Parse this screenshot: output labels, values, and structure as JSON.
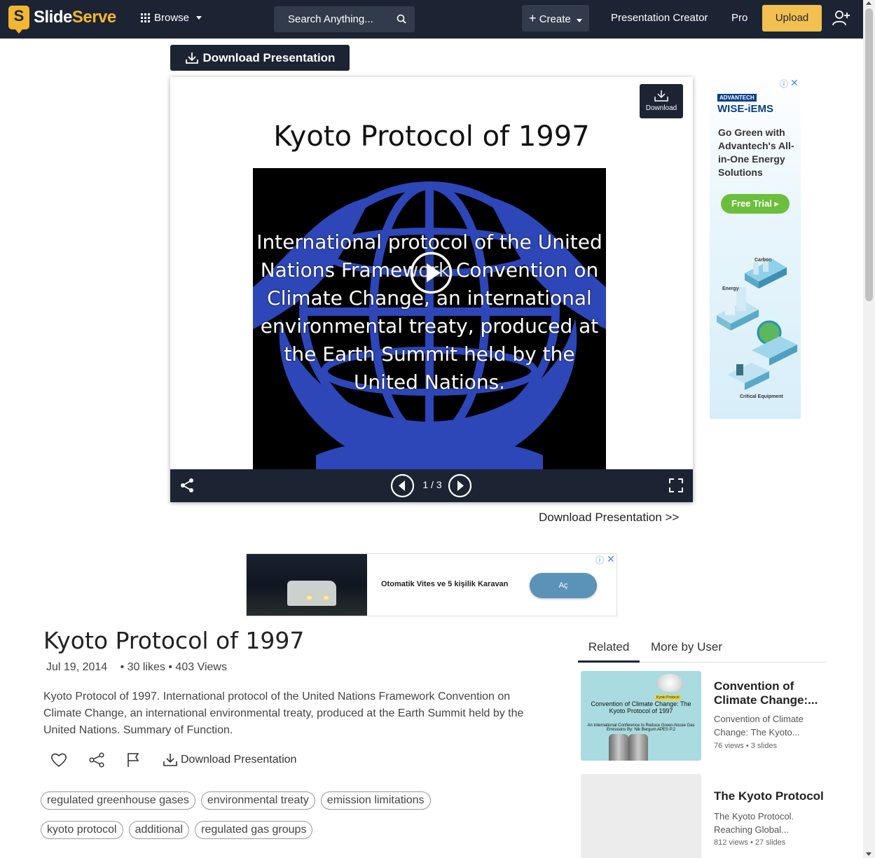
{
  "nav": {
    "logo_s": "S",
    "logo_slide": "Slide",
    "logo_serve": "Serve",
    "browse": "Browse",
    "search_placeholder": "Search Anything...",
    "create": "Create",
    "presentation_creator": "Presentation Creator",
    "pro": "Pro",
    "upload": "Upload"
  },
  "viewer": {
    "download_button": "Download Presentation",
    "corner_download": "Download",
    "slide_title": "Kyoto Protocol of 1997",
    "slide_text": "International protocol of the United Nations Framework Convention on Climate Change, an international environmental treaty, produced at the Earth Summit held by the United Nations.",
    "page_counter": "1 / 3",
    "download_link": "Download Presentation >>"
  },
  "side_ad": {
    "brand": "ADVANTECH",
    "product": "WISE-iEMS",
    "copy": "Go Green with Advantech's All-in-One Energy Solutions",
    "cta": "Free Trial ▸",
    "label_carbon": "Carbon",
    "label_energy": "Energy",
    "label_critical": "Critical Equipment"
  },
  "banner_ad": {
    "text": "Otomatik Vites ve 5 kişilik Karavan",
    "button": "Aç"
  },
  "details": {
    "title": "Kyoto Protocol of 1997",
    "date": "Jul 19, 2014",
    "likes_views": "• 30 likes • 403 Views",
    "description": "Kyoto Protocol of 1997. International protocol of the United Nations Framework Convention on Climate Change, an international environmental treaty, produced at the Earth Summit held by the United Nations. Summary of Function.",
    "download_action": "Download Presentation",
    "tags_row1": [
      "regulated greenhouse gases",
      "environmental treaty",
      "emission limitations"
    ],
    "tags_row2": [
      "kyoto protocol",
      "additional",
      "regulated gas groups"
    ]
  },
  "related": {
    "tab_related": "Related",
    "tab_more": "More by User",
    "items": [
      {
        "title": "Convention of Climate Change:...",
        "subtitle": "Convention of Climate Change: The Kyoto...",
        "stats": "76 views • 3 slides",
        "thumb_line1": "Convention of Climate Change: The Kyoto Protocol of 1997",
        "thumb_line2": "An International Conference to Reduce Green-house Gas Emissions By: Nik Bergum APES P.2",
        "thumb_badge": "Kyoto Protocol"
      },
      {
        "title": "The Kyoto Protocol",
        "subtitle": "The Kyoto Protocol. Reaching Global...",
        "stats": "812 views • 27 slides"
      }
    ]
  },
  "colors": {
    "nav_bg": "#1c2433",
    "accent": "#f2b630",
    "upload_bg": "#f2c04f"
  }
}
